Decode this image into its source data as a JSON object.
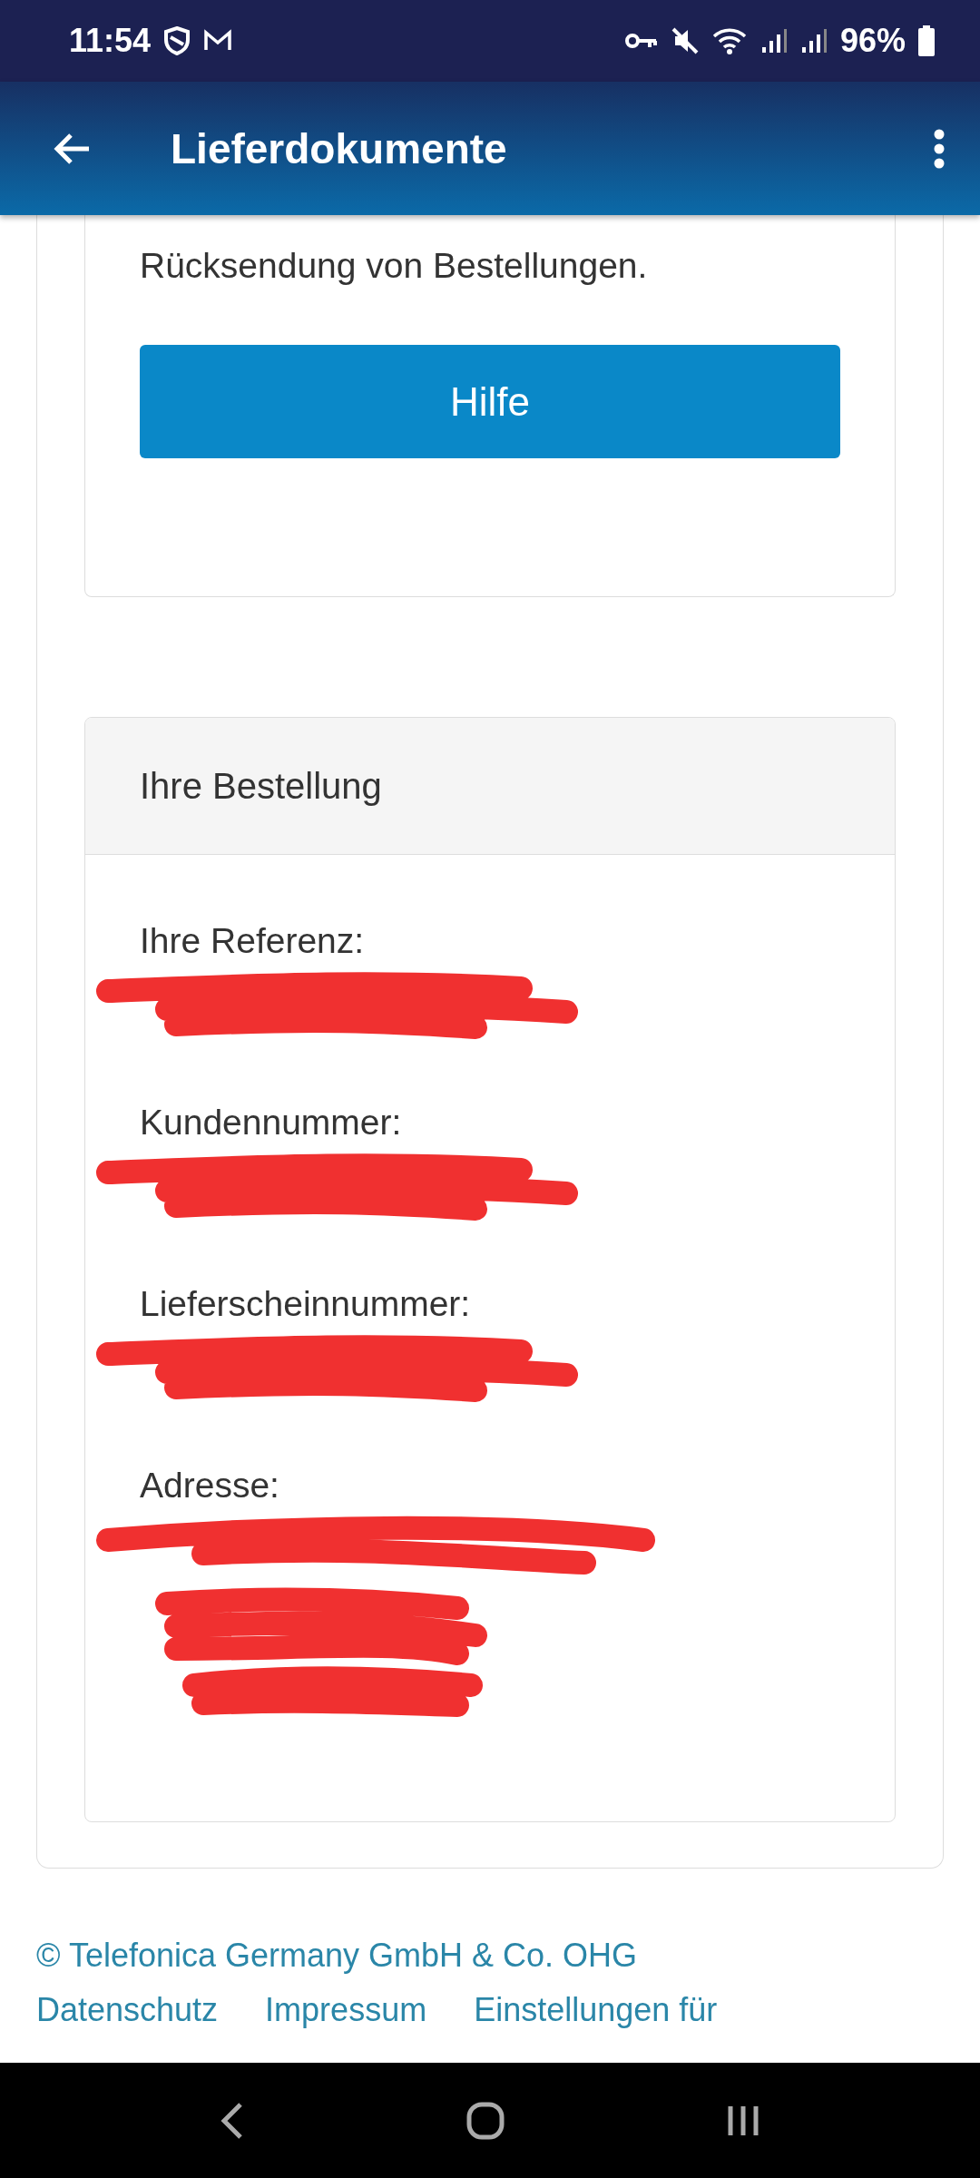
{
  "status_bar": {
    "time": "11:54",
    "battery": "96%"
  },
  "app_bar": {
    "title": "Lieferdokumente"
  },
  "help_card": {
    "text": "Rücksendung von Bestellungen.",
    "button": "Hilfe"
  },
  "order_card": {
    "title": "Ihre Bestellung",
    "fields": [
      {
        "label": "Ihre Referenz:",
        "kind": "line"
      },
      {
        "label": "Kundennummer:",
        "kind": "line"
      },
      {
        "label": "Lieferscheinnummer:",
        "kind": "line"
      },
      {
        "label": "Adresse:",
        "kind": "block"
      }
    ]
  },
  "footer": {
    "copyright": "© Telefonica Germany GmbH & Co. OHG",
    "links": [
      "Datenschutz",
      "Impressum",
      "Einstellungen für"
    ]
  }
}
